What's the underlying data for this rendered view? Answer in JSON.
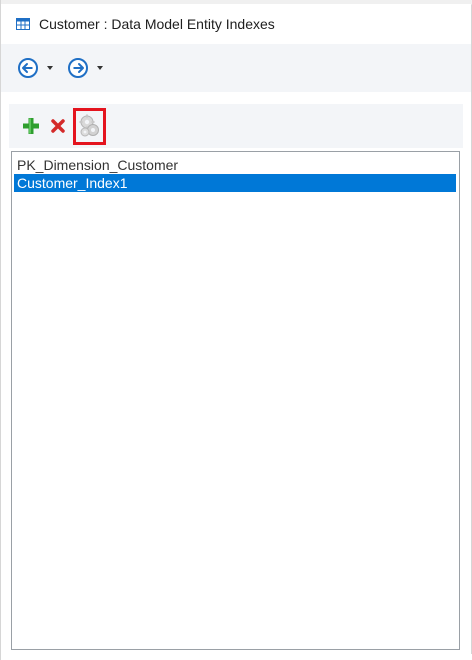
{
  "window": {
    "title": "Customer : Data Model Entity Indexes",
    "title_icon": "table-icon"
  },
  "navigation": {
    "back_icon": "back-arrow-icon",
    "forward_icon": "forward-arrow-icon"
  },
  "toolbar": {
    "add_icon": "plus-icon",
    "delete_icon": "delete-x-icon",
    "settings_icon": "settings-gears-icon",
    "highlight_color": "#e4141e"
  },
  "index_list": {
    "items": [
      {
        "label": "PK_Dimension_Customer",
        "selected": false
      },
      {
        "label": "Customer_Index1",
        "selected": true
      }
    ],
    "selection_color": "#0078d7"
  }
}
